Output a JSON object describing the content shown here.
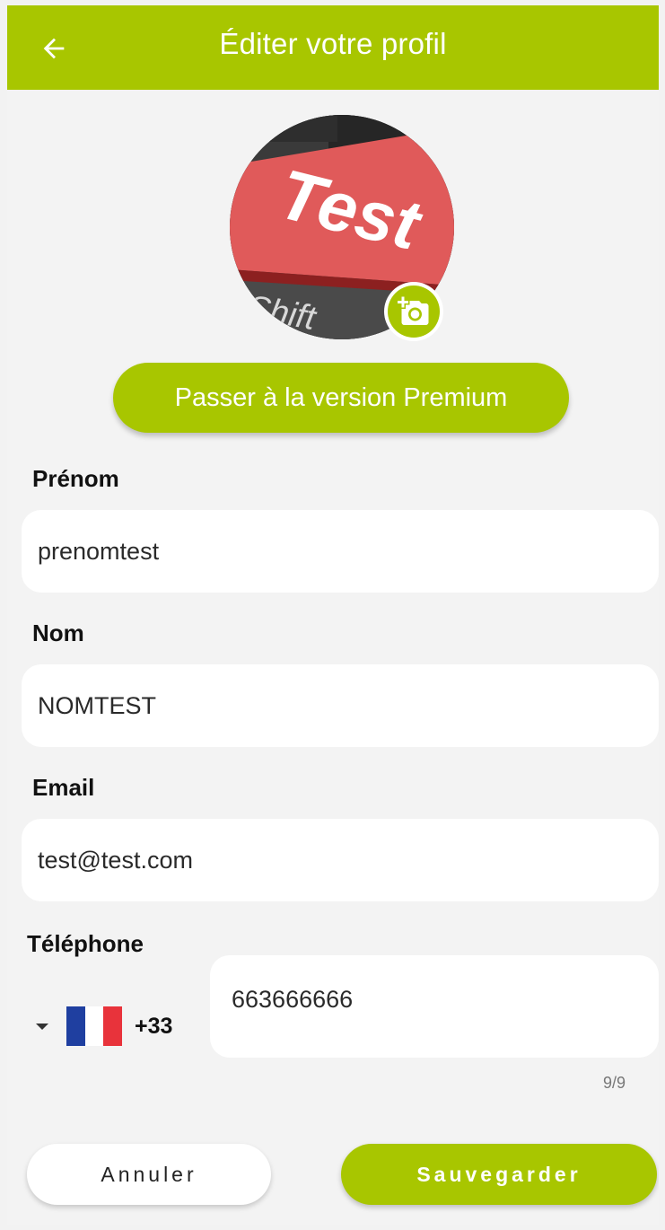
{
  "header": {
    "title": "Éditer votre profil",
    "back_icon": "arrow-left-icon"
  },
  "avatar": {
    "picture_text_main": "Test",
    "picture_text_key": "Shift",
    "camera_icon": "add-photo-icon"
  },
  "premium_button": {
    "label": "Passer à la version Premium"
  },
  "form": {
    "first_name": {
      "label": "Prénom",
      "value": "prenomtest"
    },
    "last_name": {
      "label": "Nom",
      "value": "NOMTEST"
    },
    "email": {
      "label": "Email",
      "value": "test@test.com"
    },
    "phone": {
      "label": "Téléphone",
      "country_code": "+33",
      "value": "663666666",
      "counter": "9/9",
      "flag_colors": [
        "#1f3fa0",
        "#ffffff",
        "#e8333b"
      ]
    }
  },
  "actions": {
    "cancel_label": "Annuler",
    "save_label": "Sauvegarder"
  },
  "colors": {
    "accent": "#a8c600",
    "background": "#f3f3f3"
  }
}
